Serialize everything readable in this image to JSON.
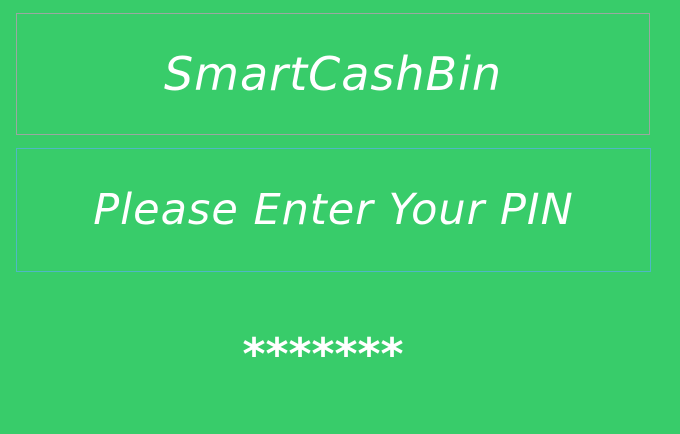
{
  "app": {
    "title": "SmartCashBin"
  },
  "prompt": {
    "text": "Please Enter Your PIN"
  },
  "pin": {
    "masked_value": "*******"
  },
  "colors": {
    "background": "#38cc6a",
    "text": "#ffffff"
  }
}
